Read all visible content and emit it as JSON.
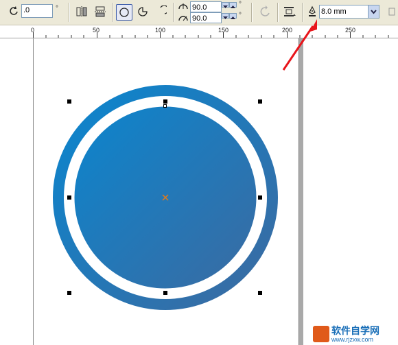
{
  "toolbar": {
    "rotation_value": ".0",
    "rotation_unit": "°",
    "start_angle": "90.0",
    "end_angle": "90.0",
    "angle_unit": "°",
    "outline_width": "8.0 mm"
  },
  "ruler": {
    "ticks": [
      "0",
      "50",
      "100",
      "150",
      "200",
      "250"
    ]
  },
  "colors": {
    "ellipse_gradient_start": "#0a86cf",
    "ellipse_gradient_end": "#3c6aa0",
    "annotation_arrow": "#e8151b"
  },
  "watermark": {
    "brand": "软件自学网",
    "url": "www.rjzxw.com"
  },
  "icons": {
    "rotation": "rotate-icon",
    "mirror_h": "mirror-horizontal-icon",
    "mirror_v": "mirror-vertical-icon",
    "ellipse": "ellipse-icon",
    "pie": "pie-icon",
    "arc": "arc-icon",
    "direction": "direction-icon",
    "wrap": "wrap-paragraph-icon",
    "outline_pen": "outline-pen-icon"
  }
}
